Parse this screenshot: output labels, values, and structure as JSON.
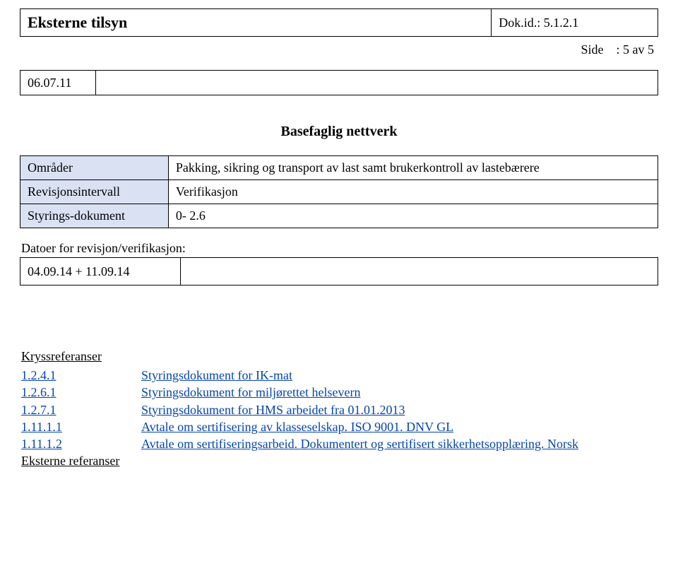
{
  "header": {
    "title": "Eksterne tilsyn",
    "docid_label": "Dok.id.:",
    "docid_value": "5.1.2.1"
  },
  "side": {
    "label": "Side",
    "value": ": 5 av 5"
  },
  "small_box": {
    "left": "06.07.11",
    "right": ""
  },
  "section_title": "Basefaglig nettverk",
  "props": {
    "rows": [
      {
        "label": "Områder",
        "value": "Pakking, sikring og transport av last samt brukerkontroll av lastebærere"
      },
      {
        "label": "Revisjonsintervall",
        "value": "Verifikasjon"
      },
      {
        "label": "Styrings-dokument",
        "value": "0- 2.6"
      }
    ]
  },
  "dates": {
    "heading": "Datoer for revisjon/verifikasjon:",
    "left": "04.09.14 + 11.09.14",
    "right": ""
  },
  "kryss_heading": "Kryssreferanser",
  "refs": [
    {
      "num": "1.2.4.1",
      "text": "Styringsdokument for IK-mat"
    },
    {
      "num": "1.2.6.1",
      "text": "Styringsdokument for miljørettet helsevern"
    },
    {
      "num": "1.2.7.1",
      "text": "Styringsdokument for HMS arbeidet fra 01.01.2013"
    },
    {
      "num": "1.11.1.1",
      "text": "Avtale om sertifisering av klasseselskap. ISO 9001. DNV GL"
    },
    {
      "num": "1.11.1.2",
      "text": "Avtale om sertifiseringsarbeid. Dokumentert og sertifisert sikkerhetsopplæring. Norsk"
    }
  ],
  "ext_heading": "Eksterne referanser"
}
